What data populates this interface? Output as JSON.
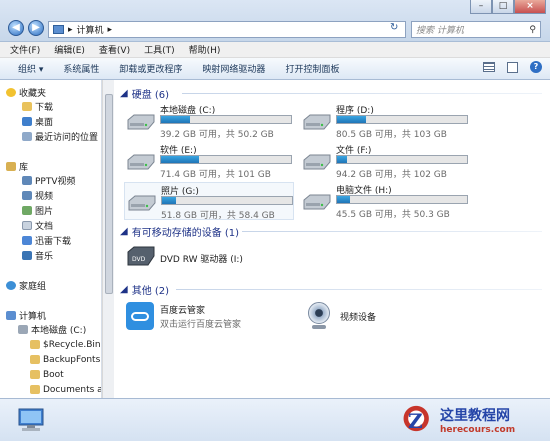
{
  "window": {
    "address_path": "计算机",
    "search_placeholder": "搜索 计算机",
    "buttons": {
      "minimize": "–",
      "maximize": "□",
      "close": "×"
    }
  },
  "menu": [
    "文件(F)",
    "编辑(E)",
    "查看(V)",
    "工具(T)",
    "帮助(H)"
  ],
  "toolbar": [
    "组织 ▾",
    "系统属性",
    "卸载或更改程序",
    "映射网络驱动器",
    "打开控制面板"
  ],
  "sidebar": {
    "favorites_header": "收藏夹",
    "favorites": [
      "下载",
      "桌面",
      "最近访问的位置"
    ],
    "library_header": "库",
    "libraries": [
      "PPTV视频",
      "视频",
      "图片",
      "文档",
      "迅雷下载",
      "音乐"
    ],
    "homegroup": "家庭组",
    "computer_header": "计算机",
    "local_disk": "本地磁盘 (C:)",
    "folders": [
      "$Recycle.Bin",
      "BackupFonts",
      "Boot",
      "Documents and"
    ]
  },
  "sections": {
    "hard_disks": "硬盘 (6)",
    "removable": "有可移动存储的设备 (1)",
    "other": "其他 (2)"
  },
  "drives": [
    {
      "name": "本地磁盘 (C:)",
      "space": "39.2 GB 可用，共 50.2 GB",
      "used_fraction": 0.22
    },
    {
      "name": "程序 (D:)",
      "space": "80.5 GB 可用，共 103 GB",
      "used_fraction": 0.22
    },
    {
      "name": "软件 (E:)",
      "space": "71.4 GB 可用，共 101 GB",
      "used_fraction": 0.29
    },
    {
      "name": "文件 (F:)",
      "space": "94.2 GB 可用，共 102 GB",
      "used_fraction": 0.08
    },
    {
      "name": "照片 (G:)",
      "space": "51.8 GB 可用，共 58.4 GB",
      "used_fraction": 0.11
    },
    {
      "name": "电脑文件 (H:)",
      "space": "45.5 GB 可用，共 50.3 GB",
      "used_fraction": 0.1
    }
  ],
  "dvd": {
    "name": "DVD RW 驱动器 (I:)",
    "icon_label": "DVD"
  },
  "other_items": [
    {
      "name": "百度云管家",
      "desc": "双击运行百度云管家"
    },
    {
      "name": "视频设备"
    }
  ],
  "watermark": {
    "title": "这里教程网",
    "url": "herecours.com"
  }
}
